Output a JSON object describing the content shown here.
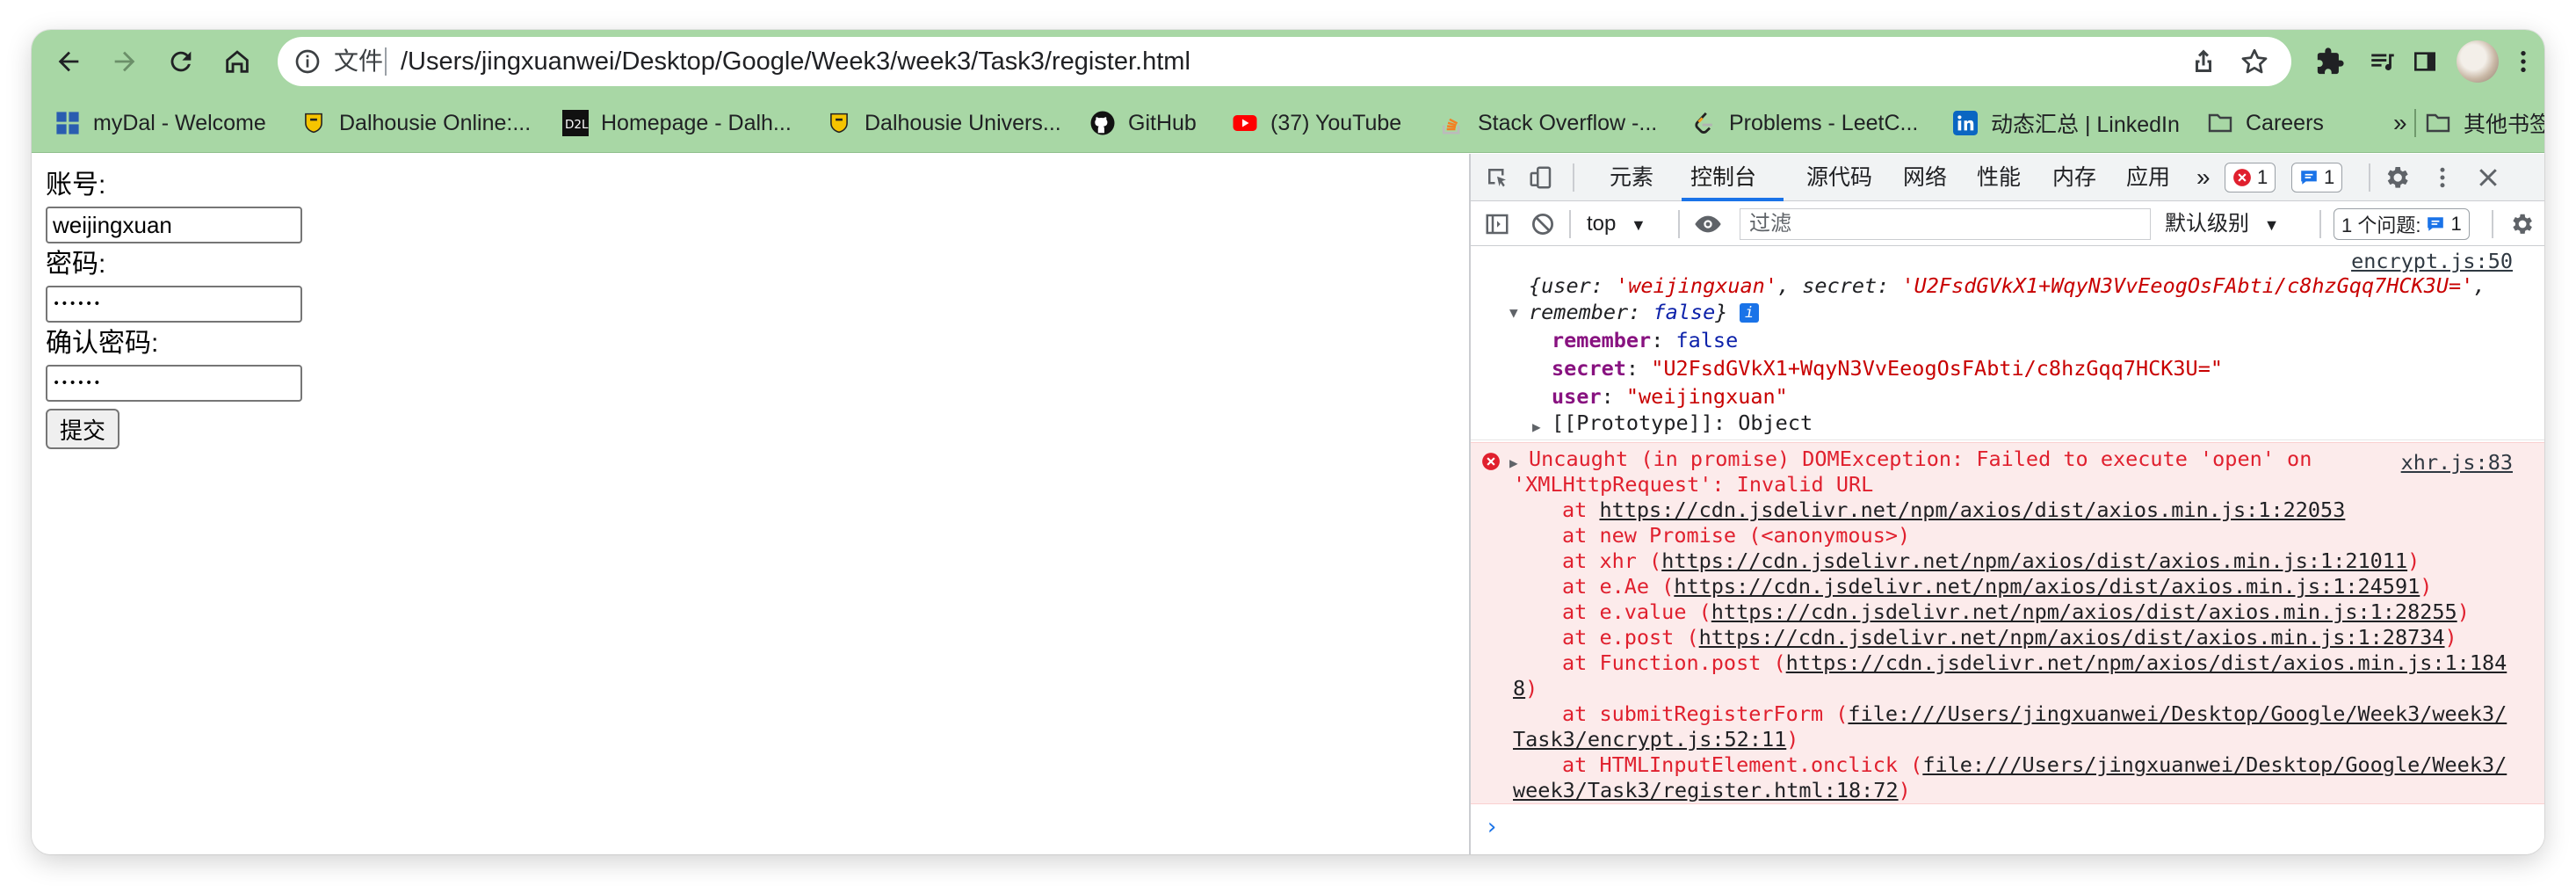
{
  "toolbar": {
    "scheme_label": "文件",
    "url": "/Users/jingxuanwei/Desktop/Google/Week3/week3/Task3/register.html"
  },
  "bookmarks": [
    {
      "label": "myDal - Welcome",
      "icon": "windows-grid-icon"
    },
    {
      "label": "Dalhousie Online:...",
      "icon": "dal-crest-icon"
    },
    {
      "label": "Homepage - Dalh...",
      "icon": "d2l-icon"
    },
    {
      "label": "Dalhousie Univers...",
      "icon": "dal-crest-icon"
    },
    {
      "label": "GitHub",
      "icon": "github-icon"
    },
    {
      "label": "(37) YouTube",
      "icon": "youtube-icon"
    },
    {
      "label": "Stack Overflow -...",
      "icon": "stackoverflow-icon"
    },
    {
      "label": "Problems - LeetC...",
      "icon": "leetcode-icon"
    },
    {
      "label": "动态汇总 | LinkedIn",
      "icon": "linkedin-icon"
    },
    {
      "label": "Careers",
      "icon": "folder-icon"
    }
  ],
  "bookmarks_overflow": "»",
  "other_bookmarks": "其他书签",
  "form": {
    "account_label": "账号:",
    "account_value": "weijingxuan",
    "password_label": "密码:",
    "password_dots": "••••••",
    "confirm_label": "确认密码:",
    "confirm_dots": "••••••",
    "submit_label": "提交"
  },
  "devtools": {
    "tabs": [
      "元素",
      "控制台",
      "源代码",
      "网络",
      "性能",
      "内存",
      "应用"
    ],
    "active_tab": "控制台",
    "more_tabs": "»",
    "error_count": "1",
    "info_count": "1",
    "context": "top",
    "filter_placeholder": "过滤",
    "log_level": "默认级别",
    "issues_label": "1 个问题:",
    "issues_count": "1"
  },
  "console": {
    "log_source": "encrypt.js:50",
    "obj_summary_user_key": "user",
    "obj_summary_user_val": "'weijingxuan'",
    "obj_summary_secret_key": "secret",
    "obj_summary_secret_val": "'U2FsdGVkX1+WqyN3VvEeogOsFAbti/c8hzGqq7HCK3U='",
    "obj_summary_remember_key": "remember",
    "obj_summary_remember_val": "false",
    "props": [
      {
        "key": "remember",
        "value": "false"
      },
      {
        "key": "secret",
        "value": "\"U2FsdGVkX1+WqyN3VvEeogOsFAbti/c8hzGqq7HCK3U=\""
      },
      {
        "key": "user",
        "value": "\"weijingxuan\""
      }
    ],
    "prototype_label": "[[Prototype]]: Object",
    "error_source": "xhr.js:83",
    "error_line1": "Uncaught (in promise) DOMException: Failed to execute 'open' on",
    "error_line2": "'XMLHttpRequest': Invalid URL",
    "stack": {
      "s1_pre": "at ",
      "s1_link": "https://cdn.jsdelivr.net/npm/axios/dist/axios.min.js:1:22053",
      "s2": "at new Promise (<anonymous>)",
      "s3_pre": "at xhr (",
      "s3_link": "https://cdn.jsdelivr.net/npm/axios/dist/axios.min.js:1:21011",
      "s3_post": ")",
      "s4_pre": "at e.Ae (",
      "s4_link": "https://cdn.jsdelivr.net/npm/axios/dist/axios.min.js:1:24591",
      "s4_post": ")",
      "s5_pre": "at e.value (",
      "s5_link": "https://cdn.jsdelivr.net/npm/axios/dist/axios.min.js:1:28255",
      "s5_post": ")",
      "s6_pre": "at e.post (",
      "s6_link": "https://cdn.jsdelivr.net/npm/axios/dist/axios.min.js:1:28734",
      "s6_post": ")",
      "s7_pre": "at Function.post (",
      "s7_link": "https://cdn.jsdelivr.net/npm/axios/dist/axios.min.js:1:184",
      "s7_wrap_link": "8",
      "s7_post": ")",
      "s8_pre": "at submitRegisterForm (",
      "s8_link": "file:///Users/jingxuanwei/Desktop/Google/Week3/week3/",
      "s8_wrap_link": "Task3/encrypt.js:52:11",
      "s8_post": ")",
      "s9_pre": "at HTMLInputElement.onclick (",
      "s9_link": "file:///Users/jingxuanwei/Desktop/Google/Week3/",
      "s9_wrap_link": "week3/Task3/register.html:18:72",
      "s9_post": ")"
    },
    "prompt": "›"
  }
}
